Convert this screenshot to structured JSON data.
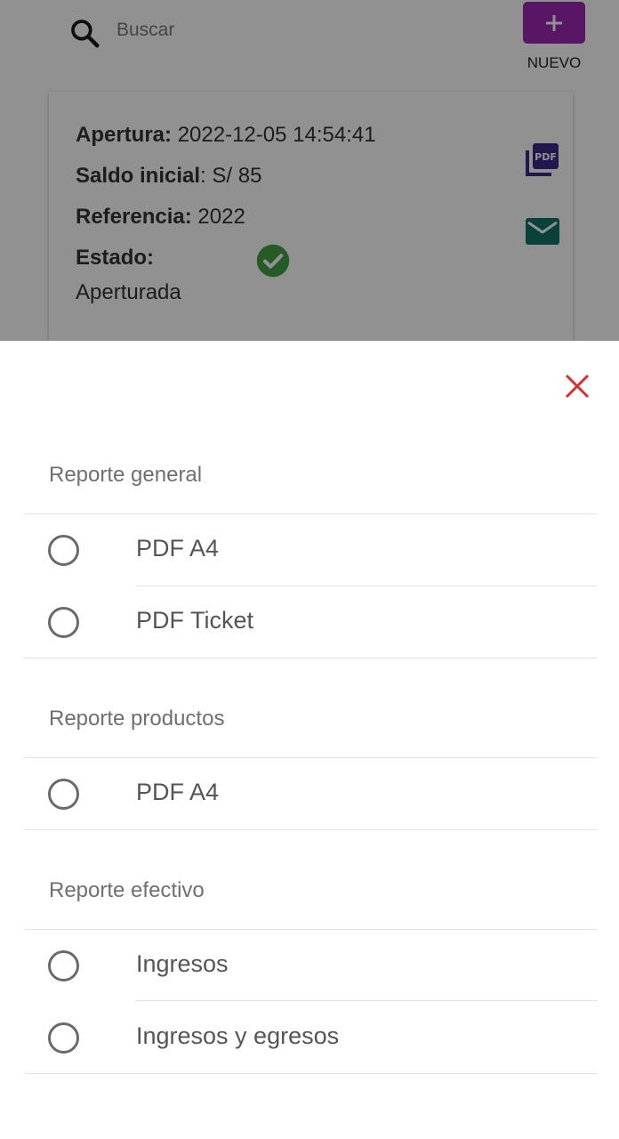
{
  "search": {
    "placeholder": "Buscar"
  },
  "new_button": {
    "label": "NUEVO"
  },
  "card": {
    "apertura_label": "Apertura:",
    "apertura_value": "2022-12-05 14:54:41",
    "saldo_label": "Saldo inicial",
    "saldo_value": ": S/ 85",
    "referencia_label": "Referencia:",
    "referencia_value": "2022",
    "estado_label": "Estado:",
    "estado_value": "Aperturada"
  },
  "sheet": {
    "sections": [
      {
        "title": "Reporte general",
        "options": [
          "PDF A4",
          "PDF Ticket"
        ]
      },
      {
        "title": "Reporte productos",
        "options": [
          "PDF A4"
        ]
      },
      {
        "title": "Reporte efectivo",
        "options": [
          "Ingresos",
          "Ingresos y egresos"
        ]
      }
    ]
  },
  "colors": {
    "accent": "#9c27b0",
    "status_ok": "#43a047",
    "pdf_icon": "#3f2a8a",
    "mail_icon": "#0f7468",
    "close": "#d32f2f"
  },
  "icons": {
    "search": "search-icon",
    "add": "plus-icon",
    "pdf": "pdf-icon",
    "mail": "mail-icon",
    "status": "check-circle-icon",
    "close": "close-icon",
    "radio": "radio-unchecked-icon"
  }
}
